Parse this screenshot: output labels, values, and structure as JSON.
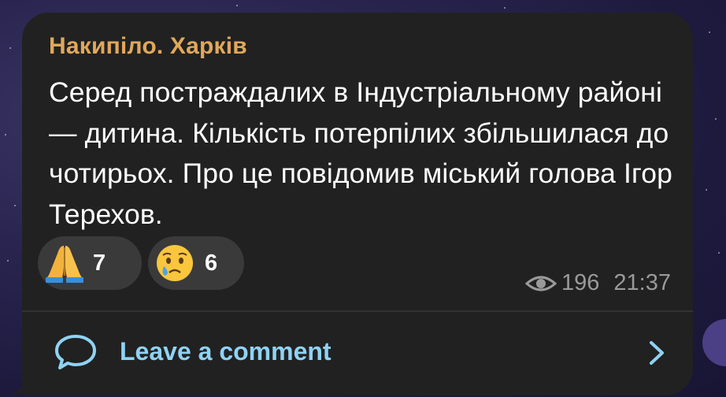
{
  "post": {
    "channel_name": "Накипіло. Харків",
    "text": "Серед постраждалих в Індустріальному районі — дитина. Кількість потерпілих збільшилася до чотирьох. Про це повідомив міський голова Ігор Терехов.",
    "reactions": [
      {
        "emoji": "folded-hands-icon",
        "count": "7"
      },
      {
        "emoji": "crying-face-icon",
        "count": "6"
      }
    ],
    "views": "196",
    "time": "21:37"
  },
  "comments": {
    "label": "Leave a comment"
  },
  "colors": {
    "bubble": "#212121",
    "sender": "#e0a85a",
    "link": "#8fd2f3",
    "meta": "#9a9a9a",
    "reaction_bg": "#3a3a3a"
  }
}
